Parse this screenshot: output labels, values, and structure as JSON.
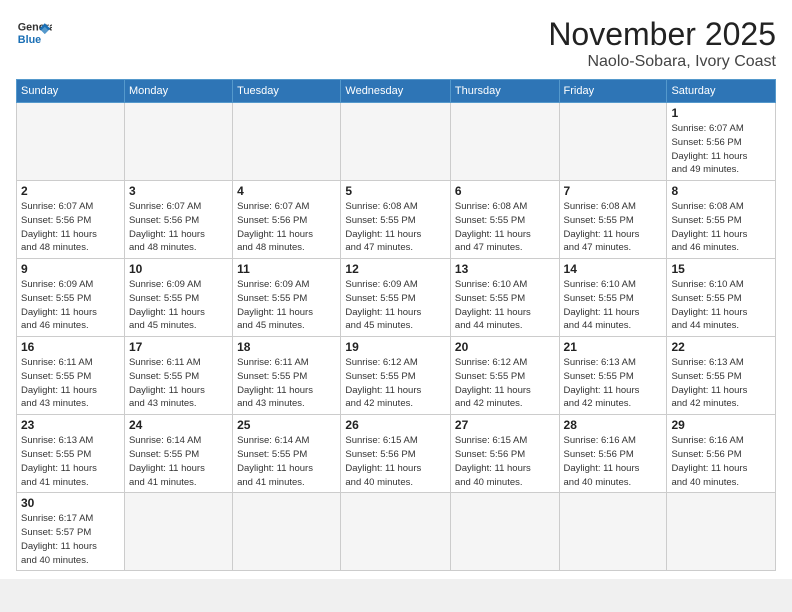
{
  "header": {
    "logo_general": "General",
    "logo_blue": "Blue",
    "month_title": "November 2025",
    "location": "Naolo-Sobara, Ivory Coast"
  },
  "weekdays": [
    "Sunday",
    "Monday",
    "Tuesday",
    "Wednesday",
    "Thursday",
    "Friday",
    "Saturday"
  ],
  "weeks": [
    [
      {
        "num": "",
        "info": ""
      },
      {
        "num": "",
        "info": ""
      },
      {
        "num": "",
        "info": ""
      },
      {
        "num": "",
        "info": ""
      },
      {
        "num": "",
        "info": ""
      },
      {
        "num": "",
        "info": ""
      },
      {
        "num": "1",
        "info": "Sunrise: 6:07 AM\nSunset: 5:56 PM\nDaylight: 11 hours\nand 49 minutes."
      }
    ],
    [
      {
        "num": "2",
        "info": "Sunrise: 6:07 AM\nSunset: 5:56 PM\nDaylight: 11 hours\nand 48 minutes."
      },
      {
        "num": "3",
        "info": "Sunrise: 6:07 AM\nSunset: 5:56 PM\nDaylight: 11 hours\nand 48 minutes."
      },
      {
        "num": "4",
        "info": "Sunrise: 6:07 AM\nSunset: 5:56 PM\nDaylight: 11 hours\nand 48 minutes."
      },
      {
        "num": "5",
        "info": "Sunrise: 6:08 AM\nSunset: 5:55 PM\nDaylight: 11 hours\nand 47 minutes."
      },
      {
        "num": "6",
        "info": "Sunrise: 6:08 AM\nSunset: 5:55 PM\nDaylight: 11 hours\nand 47 minutes."
      },
      {
        "num": "7",
        "info": "Sunrise: 6:08 AM\nSunset: 5:55 PM\nDaylight: 11 hours\nand 47 minutes."
      },
      {
        "num": "8",
        "info": "Sunrise: 6:08 AM\nSunset: 5:55 PM\nDaylight: 11 hours\nand 46 minutes."
      }
    ],
    [
      {
        "num": "9",
        "info": "Sunrise: 6:09 AM\nSunset: 5:55 PM\nDaylight: 11 hours\nand 46 minutes."
      },
      {
        "num": "10",
        "info": "Sunrise: 6:09 AM\nSunset: 5:55 PM\nDaylight: 11 hours\nand 45 minutes."
      },
      {
        "num": "11",
        "info": "Sunrise: 6:09 AM\nSunset: 5:55 PM\nDaylight: 11 hours\nand 45 minutes."
      },
      {
        "num": "12",
        "info": "Sunrise: 6:09 AM\nSunset: 5:55 PM\nDaylight: 11 hours\nand 45 minutes."
      },
      {
        "num": "13",
        "info": "Sunrise: 6:10 AM\nSunset: 5:55 PM\nDaylight: 11 hours\nand 44 minutes."
      },
      {
        "num": "14",
        "info": "Sunrise: 6:10 AM\nSunset: 5:55 PM\nDaylight: 11 hours\nand 44 minutes."
      },
      {
        "num": "15",
        "info": "Sunrise: 6:10 AM\nSunset: 5:55 PM\nDaylight: 11 hours\nand 44 minutes."
      }
    ],
    [
      {
        "num": "16",
        "info": "Sunrise: 6:11 AM\nSunset: 5:55 PM\nDaylight: 11 hours\nand 43 minutes."
      },
      {
        "num": "17",
        "info": "Sunrise: 6:11 AM\nSunset: 5:55 PM\nDaylight: 11 hours\nand 43 minutes."
      },
      {
        "num": "18",
        "info": "Sunrise: 6:11 AM\nSunset: 5:55 PM\nDaylight: 11 hours\nand 43 minutes."
      },
      {
        "num": "19",
        "info": "Sunrise: 6:12 AM\nSunset: 5:55 PM\nDaylight: 11 hours\nand 42 minutes."
      },
      {
        "num": "20",
        "info": "Sunrise: 6:12 AM\nSunset: 5:55 PM\nDaylight: 11 hours\nand 42 minutes."
      },
      {
        "num": "21",
        "info": "Sunrise: 6:13 AM\nSunset: 5:55 PM\nDaylight: 11 hours\nand 42 minutes."
      },
      {
        "num": "22",
        "info": "Sunrise: 6:13 AM\nSunset: 5:55 PM\nDaylight: 11 hours\nand 42 minutes."
      }
    ],
    [
      {
        "num": "23",
        "info": "Sunrise: 6:13 AM\nSunset: 5:55 PM\nDaylight: 11 hours\nand 41 minutes."
      },
      {
        "num": "24",
        "info": "Sunrise: 6:14 AM\nSunset: 5:55 PM\nDaylight: 11 hours\nand 41 minutes."
      },
      {
        "num": "25",
        "info": "Sunrise: 6:14 AM\nSunset: 5:55 PM\nDaylight: 11 hours\nand 41 minutes."
      },
      {
        "num": "26",
        "info": "Sunrise: 6:15 AM\nSunset: 5:56 PM\nDaylight: 11 hours\nand 40 minutes."
      },
      {
        "num": "27",
        "info": "Sunrise: 6:15 AM\nSunset: 5:56 PM\nDaylight: 11 hours\nand 40 minutes."
      },
      {
        "num": "28",
        "info": "Sunrise: 6:16 AM\nSunset: 5:56 PM\nDaylight: 11 hours\nand 40 minutes."
      },
      {
        "num": "29",
        "info": "Sunrise: 6:16 AM\nSunset: 5:56 PM\nDaylight: 11 hours\nand 40 minutes."
      }
    ],
    [
      {
        "num": "30",
        "info": "Sunrise: 6:17 AM\nSunset: 5:57 PM\nDaylight: 11 hours\nand 40 minutes."
      },
      {
        "num": "",
        "info": ""
      },
      {
        "num": "",
        "info": ""
      },
      {
        "num": "",
        "info": ""
      },
      {
        "num": "",
        "info": ""
      },
      {
        "num": "",
        "info": ""
      },
      {
        "num": "",
        "info": ""
      }
    ]
  ]
}
